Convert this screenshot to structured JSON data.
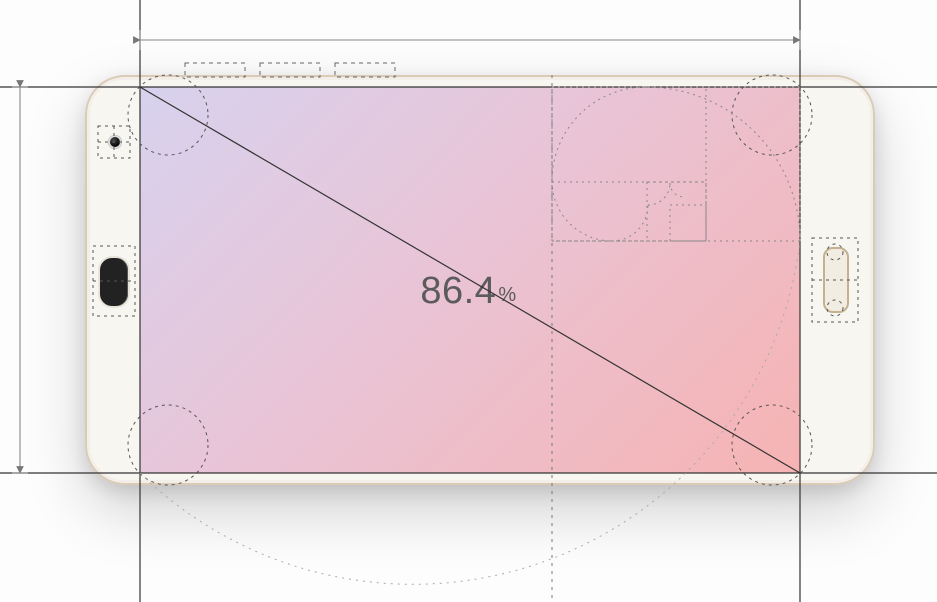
{
  "diagram": {
    "ratio_value": "86.4",
    "ratio_unit": "%",
    "description": "Screen-to-body ratio illustration with golden-ratio & guideline overlays on a smartphone outline"
  },
  "phone": {
    "orientation": "landscape",
    "camera": "front-camera",
    "speaker": "earpiece-speaker",
    "home_button": "home-button"
  },
  "guides": {
    "style": "blueprint",
    "elements": [
      "golden-spiral",
      "corner-circles",
      "diagonal",
      "dimension-arrows",
      "dashed-construction-lines"
    ]
  }
}
